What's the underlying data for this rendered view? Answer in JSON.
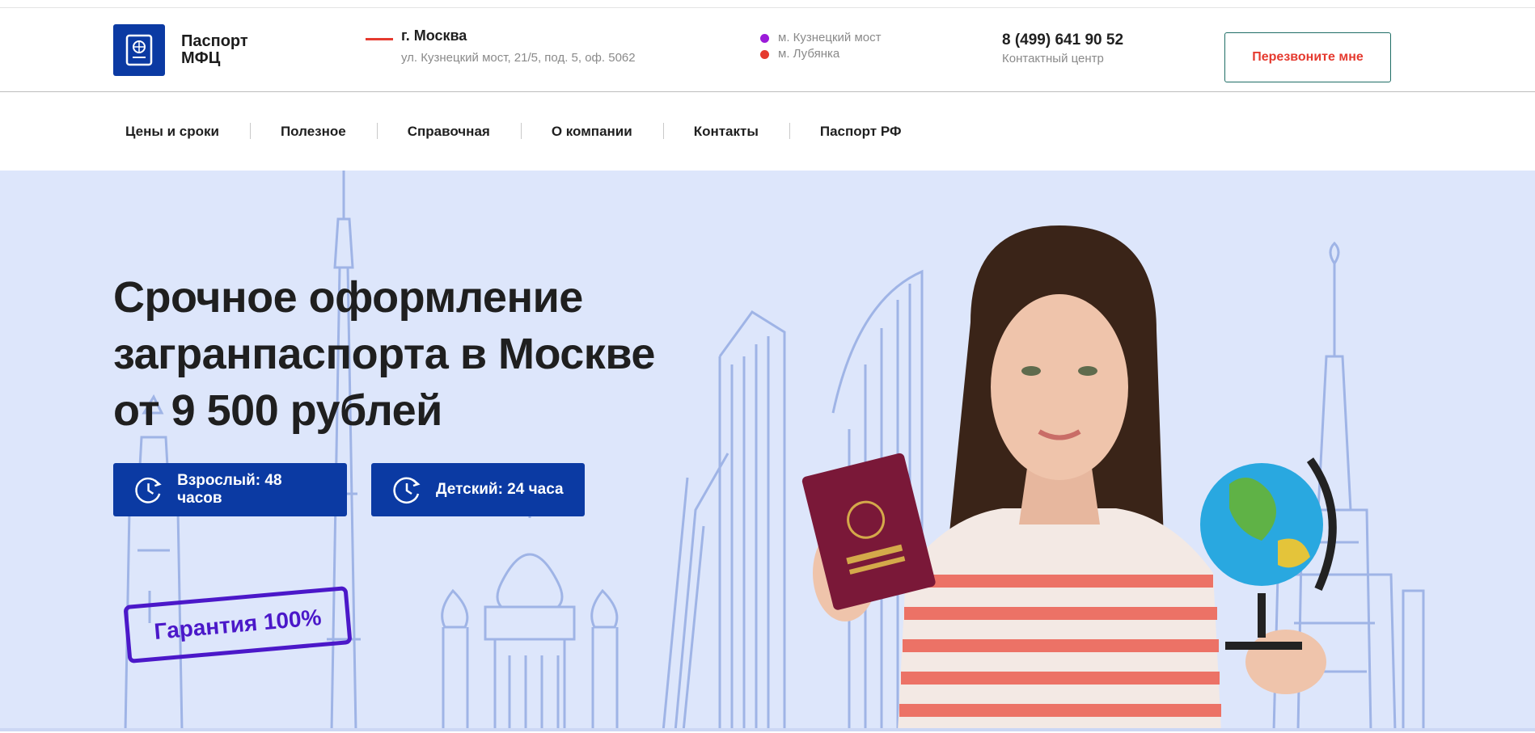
{
  "brand": {
    "logo_line1": "Паспорт",
    "logo_line2": "МФЦ",
    "accent": "#0b3aa3",
    "red": "#e53a2f"
  },
  "header": {
    "city": "г. Москва",
    "address": "ул. Кузнецкий мост, 21/5, под. 5, оф. 5062",
    "metro": [
      {
        "name": "м. Кузнецкий мост",
        "color": "#9b1bd9"
      },
      {
        "name": "м. Лубянка",
        "color": "#e53a2f"
      }
    ],
    "phone": "8 (499) 641 90 52",
    "phone_caption": "Контактный центр",
    "callback_label": "Перезвоните мне"
  },
  "nav": {
    "items": [
      "Цены и сроки",
      "Полезное",
      "Справочная",
      "О компании",
      "Контакты",
      "Паспорт РФ"
    ]
  },
  "hero": {
    "title_line1": "Срочное оформление",
    "title_line2": "загранпаспорта в Москве",
    "title_line3": "от 9 500 рублей",
    "btn_adult": "Взрослый: 48 часов",
    "btn_child": "Детский: 24 часа",
    "stamp": "Гарантия 100%",
    "background": "#dde6fb"
  }
}
